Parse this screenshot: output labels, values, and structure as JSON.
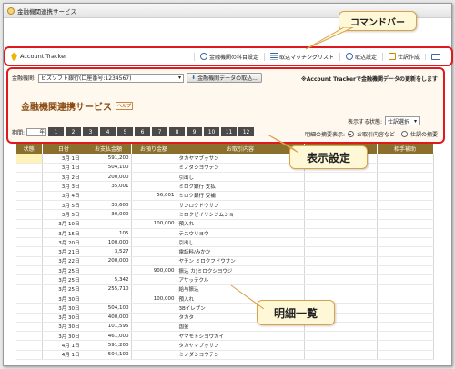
{
  "window": {
    "title": "金融機関連携サービス"
  },
  "command_bar": {
    "brand": "Account Tracker",
    "items": [
      {
        "label": "金融機関の科目設定",
        "icon": "gear-icon"
      },
      {
        "label": "取込マッチングリスト",
        "icon": "list-icon"
      },
      {
        "label": "取込設定",
        "icon": "gear-icon"
      },
      {
        "label": "仕訳作成",
        "icon": "book-icon"
      }
    ],
    "print_icon": "printer-icon"
  },
  "settings": {
    "bank_label": "金融機関:",
    "bank_value": "ビズソフト銀行(口座番号:1234567)",
    "import_button": "金融機関データの取込...",
    "notice": "※Account Trackerで金融機関データの更新をします",
    "service_title": "金融機関連携サービス",
    "help_badge": "ヘルプ",
    "period_label": "期間:",
    "year_value": "年",
    "months": [
      "1",
      "2",
      "3",
      "4",
      "5",
      "6",
      "7",
      "8",
      "9",
      "10",
      "11",
      "12"
    ],
    "display_state_label": "表示する状態:",
    "display_state_value": "仕訳選択",
    "detail_display_label": "明細の摘要表示:",
    "radio_options": [
      {
        "label": "お取引内容など",
        "selected": true
      },
      {
        "label": "仕訳の摘要",
        "selected": false
      }
    ]
  },
  "table": {
    "headers": [
      "状態",
      "日付",
      "お支払金額",
      "お預り金額",
      "お取引内容",
      "",
      "相手補助"
    ],
    "rows": [
      [
        "",
        "3月 1日",
        "591,200",
        "",
        "タカヤマブッサン"
      ],
      [
        "",
        "3月 1日",
        "504,100",
        "",
        "ミノダシヨウテン"
      ],
      [
        "",
        "3月 2日",
        "200,000",
        "",
        "引出し"
      ],
      [
        "",
        "3月 3日",
        "35,001",
        "",
        "ミロク銀行 支払"
      ],
      [
        "",
        "3月 4日",
        "",
        "56,001",
        "ミロク銀行 受補"
      ],
      [
        "",
        "3月 5日",
        "33,600",
        "",
        "サンロクドウサン"
      ],
      [
        "",
        "3月 5日",
        "30,000",
        "",
        "ミロクゼイリシジムショ"
      ],
      [
        "",
        "3月 10日",
        "",
        "100,000",
        "預入れ"
      ],
      [
        "",
        "3月 15日",
        "105",
        "",
        "テスウリヨウ"
      ],
      [
        "",
        "3月 20日",
        "100,000",
        "",
        "引出し"
      ],
      [
        "",
        "3月 21日",
        "3,527",
        "",
        "電話料/みかか"
      ],
      [
        "",
        "3月 22日",
        "200,000",
        "",
        "ヤチン ミロクフドウサン"
      ],
      [
        "",
        "3月 25日",
        "",
        "900,000",
        "振込 カ)ミロクシヨウジ"
      ],
      [
        "",
        "3月 25日",
        "5,342",
        "",
        "アサッテクル"
      ],
      [
        "",
        "3月 25日",
        "255,710",
        "",
        "給与振込"
      ],
      [
        "",
        "3月 30日",
        "",
        "100,000",
        "預入れ"
      ],
      [
        "",
        "3月 30日",
        "504,100",
        "",
        "3Bイレブン"
      ],
      [
        "",
        "3月 30日",
        "400,000",
        "",
        "タカタ"
      ],
      [
        "",
        "3月 30日",
        "101,595",
        "",
        "国金"
      ],
      [
        "",
        "3月 30日",
        "461,000",
        "",
        "ヤマモトシヨウカイ"
      ],
      [
        "",
        "4月 1日",
        "591,200",
        "",
        "タカヤマブッサン"
      ],
      [
        "",
        "4月 1日",
        "504,100",
        "",
        "ミノダシヨウテン"
      ]
    ]
  },
  "callouts": {
    "command_bar": "コマンドバー",
    "display_settings": "表示設定",
    "detail_list": "明細一覧"
  }
}
